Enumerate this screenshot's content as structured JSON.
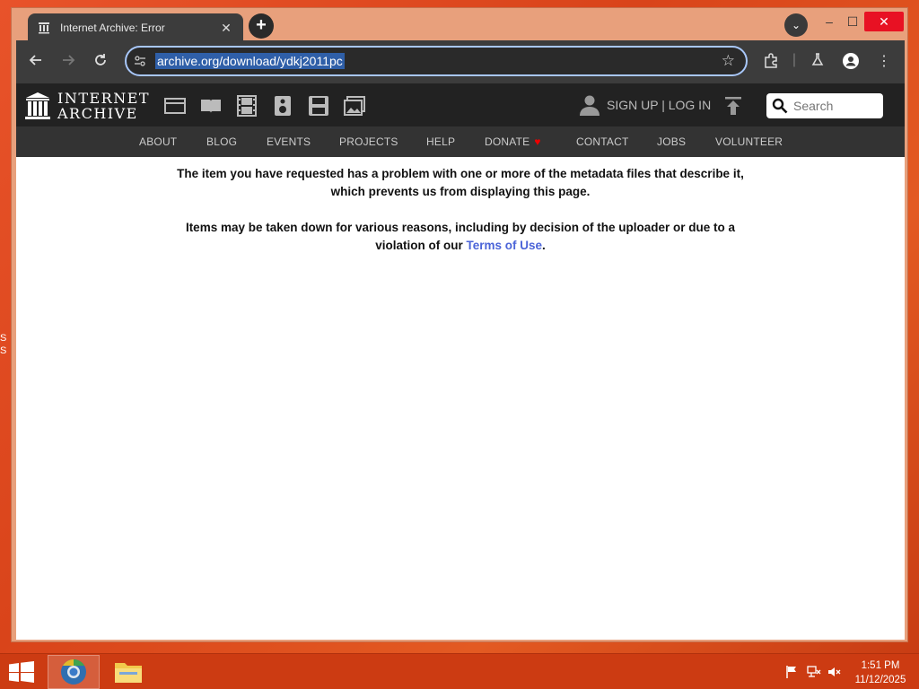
{
  "desktop": {
    "edge_glyphs": "S\nS"
  },
  "browser": {
    "tab_title": "Internet Archive: Error",
    "tab_close": "✕",
    "new_tab": "+",
    "tab_search": "⌄",
    "window_min": "–",
    "window_max": "☐",
    "window_close": "✕",
    "url": "archive.org/download/ydkj2011pc"
  },
  "ia_header": {
    "logo_line1": "INTERNET",
    "logo_line2": "ARCHIVE",
    "sign_in": "SIGN UP | LOG IN",
    "search_placeholder": "Search",
    "media_icons": [
      "web-icon",
      "texts-icon",
      "video-icon",
      "audio-icon",
      "software-icon",
      "images-icon"
    ],
    "nav": [
      "ABOUT",
      "BLOG",
      "EVENTS",
      "PROJECTS",
      "HELP",
      "DONATE",
      "CONTACT",
      "JOBS",
      "VOLUNTEER"
    ],
    "donate_heart": "♥"
  },
  "content": {
    "line1": "The item you have requested has a problem with one or more of the metadata files that describe it,",
    "line2": "which prevents us from displaying this page.",
    "line3": "Items may be taken down for various reasons, including by decision of the uploader or due to a",
    "line4_prefix": "violation of our ",
    "line4_link": "Terms of Use",
    "line4_suffix": "."
  },
  "taskbar": {
    "time": "1:51 PM",
    "date": "11/12/2025"
  },
  "colors": {
    "desktop": "#d9441a",
    "ia_header": "#222222",
    "ia_nav": "#333333",
    "link": "#4b64d8",
    "url_highlight": "#2f5fa8"
  }
}
